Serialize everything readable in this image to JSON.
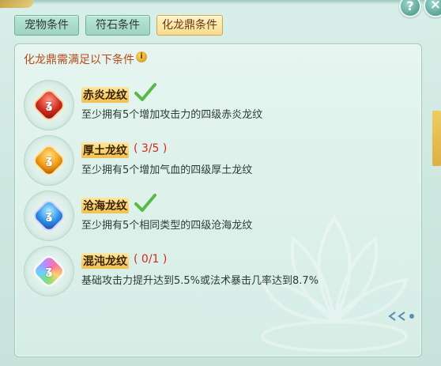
{
  "window": {
    "help_icon": "question-mark-icon",
    "close_icon": "close-icon",
    "help_text": "?",
    "close_text": "×"
  },
  "tabs": [
    {
      "label": "宠物条件",
      "active": false
    },
    {
      "label": "符石条件",
      "active": false
    },
    {
      "label": "化龙鼎条件",
      "active": true
    }
  ],
  "panel": {
    "title": "化龙鼎需满足以下条件",
    "info_icon": "info-icon",
    "info_text": "i"
  },
  "conditions": [
    {
      "name": "赤炎龙纹",
      "status": "done",
      "progress": "",
      "description": "至少拥有5个增加攻击力的四级赤炎龙纹",
      "gem_color": "#d12a1f"
    },
    {
      "name": "厚土龙纹",
      "status": "incomplete",
      "progress": "( 3/5 )",
      "description": "至少拥有5个增加气血的四级厚土龙纹",
      "gem_color": "#f29a14"
    },
    {
      "name": "沧海龙纹",
      "status": "done",
      "progress": "",
      "description": "至少拥有5个相同类型的四级沧海龙纹",
      "gem_color": "#2b8fe8"
    },
    {
      "name": "混沌龙纹",
      "status": "incomplete",
      "progress": "( 0/1 )",
      "description": "基础攻击力提升达到5.5%或法术暴击几率达到8.7%",
      "gem_color": "#b58bff"
    }
  ],
  "colors": {
    "title_red": "#b54a17",
    "progress_red": "#d8261c",
    "check_green": "#58b947",
    "active_tab_gold": "#f7dc8e"
  }
}
